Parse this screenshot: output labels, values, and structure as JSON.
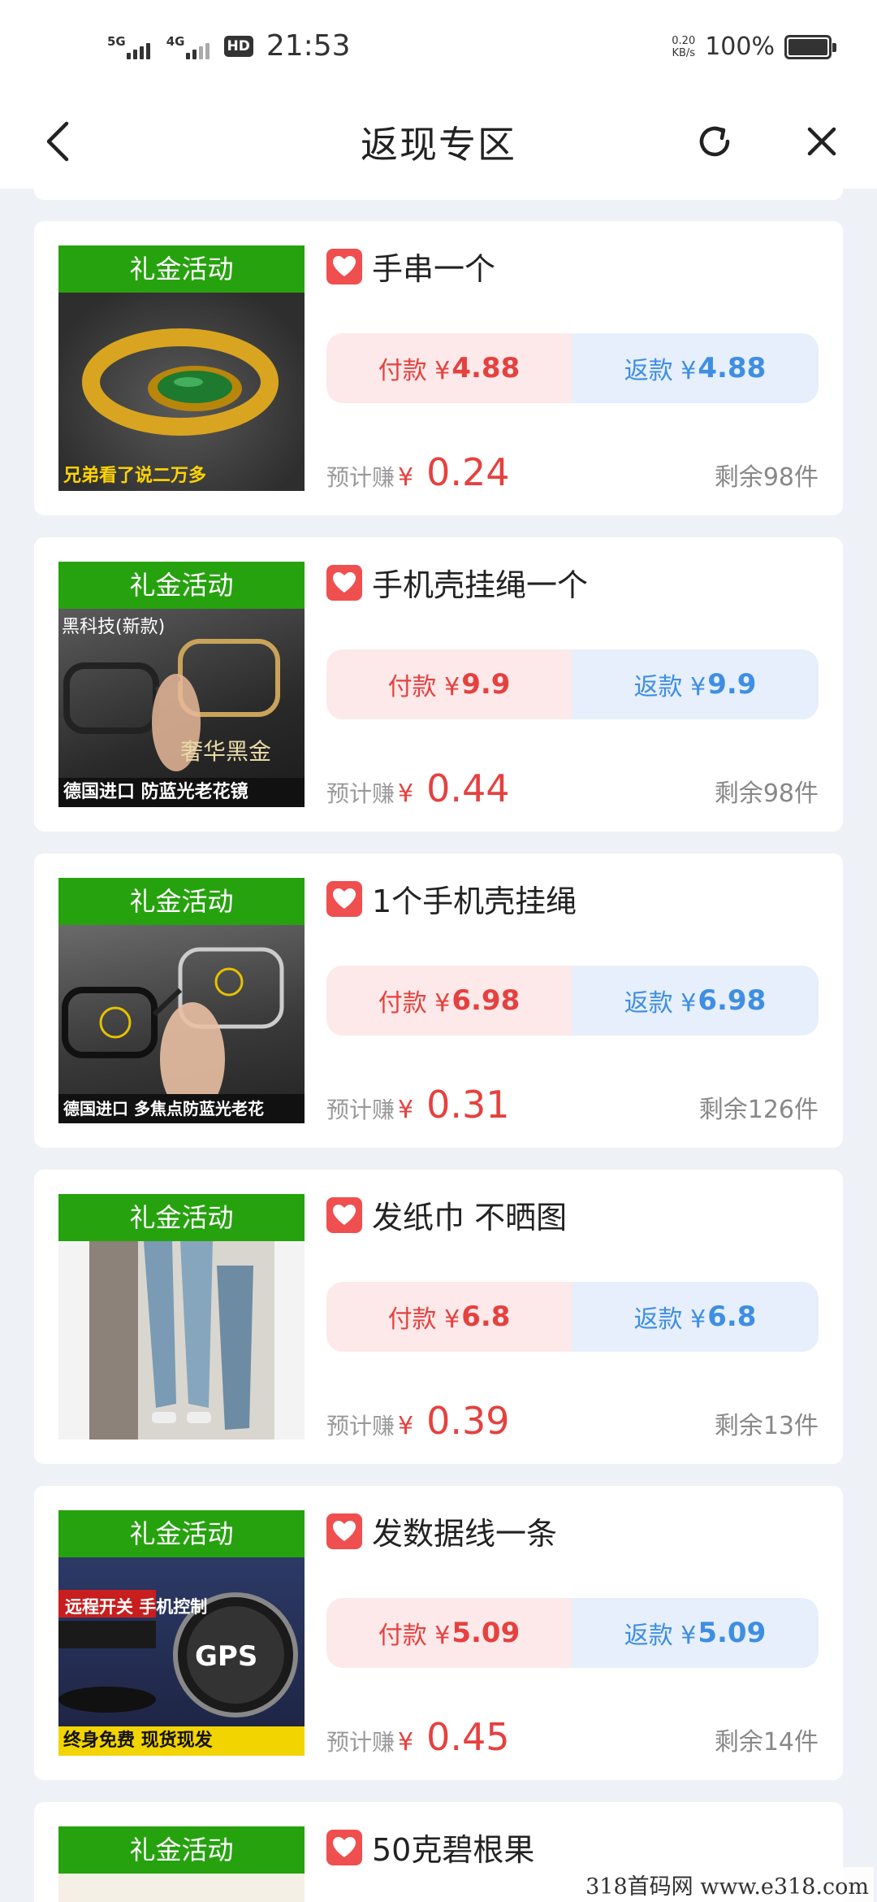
{
  "status": {
    "signal1": "5G",
    "signal2": "4G",
    "hd": "HD",
    "time": "21:53",
    "net_speed": "0.20",
    "net_unit": "KB/s",
    "battery": "100%"
  },
  "nav": {
    "title": "返现专区"
  },
  "colors": {
    "tag_green": "#27a20f",
    "pay_red": "#e5413f",
    "refund_blue": "#3f8ee3"
  },
  "items": [
    {
      "tag": "礼金活动",
      "title": "手串一个",
      "pay_label": "付款 ¥",
      "pay_amount": "4.88",
      "refund_label": "返款 ¥",
      "refund_amount": "4.88",
      "earn_label": "预计赚",
      "earn_yen": "¥",
      "earn_value": "0.24",
      "stock_prefix": "剩余",
      "stock_count": "98件",
      "caption_bottom": "兄弟看了说二万多",
      "caption_top": ""
    },
    {
      "tag": "礼金活动",
      "title": "手机壳挂绳一个",
      "pay_label": "付款 ¥",
      "pay_amount": "9.9",
      "refund_label": "返款 ¥",
      "refund_amount": "9.9",
      "earn_label": "预计赚",
      "earn_yen": "¥",
      "earn_value": "0.44",
      "stock_prefix": "剩余",
      "stock_count": "98件",
      "caption_bottom": "德国进口 防蓝光老花镜",
      "caption_top": "黑科技(新款)"
    },
    {
      "tag": "礼金活动",
      "title": "1个手机壳挂绳",
      "pay_label": "付款 ¥",
      "pay_amount": "6.98",
      "refund_label": "返款 ¥",
      "refund_amount": "6.98",
      "earn_label": "预计赚",
      "earn_yen": "¥",
      "earn_value": "0.31",
      "stock_prefix": "剩余",
      "stock_count": "126件",
      "caption_bottom": "德国进口 多焦点防蓝光老花",
      "caption_top": ""
    },
    {
      "tag": "礼金活动",
      "title": "发纸巾 不晒图",
      "pay_label": "付款 ¥",
      "pay_amount": "6.8",
      "refund_label": "返款 ¥",
      "refund_amount": "6.8",
      "earn_label": "预计赚",
      "earn_yen": "¥",
      "earn_value": "0.39",
      "stock_prefix": "剩余",
      "stock_count": "13件",
      "caption_bottom": "",
      "caption_top": ""
    },
    {
      "tag": "礼金活动",
      "title": "发数据线一条",
      "pay_label": "付款 ¥",
      "pay_amount": "5.09",
      "refund_label": "返款 ¥",
      "refund_amount": "5.09",
      "earn_label": "预计赚",
      "earn_yen": "¥",
      "earn_value": "0.45",
      "stock_prefix": "剩余",
      "stock_count": "14件",
      "caption_bottom": "终身免费 现货现发",
      "caption_top": "远程开关 手机控制",
      "badge_text": "GPS"
    },
    {
      "tag": "礼金活动",
      "title": "50克碧根果"
    }
  ],
  "watermark": "318首码网 www.e318.com"
}
